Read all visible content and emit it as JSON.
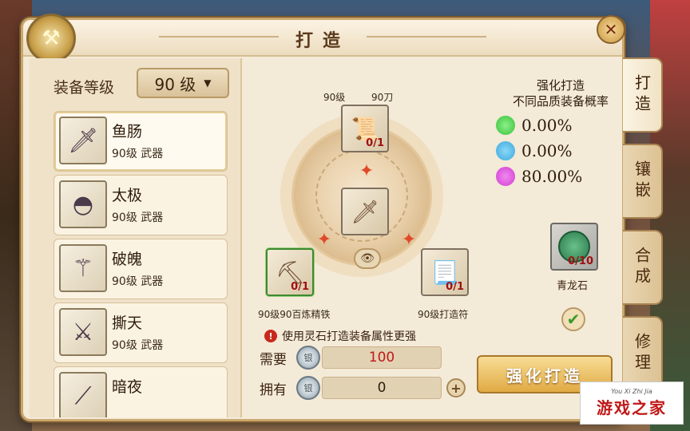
{
  "title": "打造",
  "level": {
    "label": "装备等级",
    "value": "90 级"
  },
  "items": [
    {
      "name": "鱼肠",
      "sub": "90级 武器",
      "icon": "dagger-icon"
    },
    {
      "name": "太极",
      "sub": "90级 武器",
      "icon": "fan-icon"
    },
    {
      "name": "破魄",
      "sub": "90级 武器",
      "icon": "staff-icon"
    },
    {
      "name": "撕天",
      "sub": "90级 武器",
      "icon": "claw-icon"
    },
    {
      "name": "暗夜",
      "sub": "",
      "icon": "blade-icon"
    }
  ],
  "forge": {
    "top_slot": {
      "caption_left": "90级",
      "caption_right": "90刀",
      "count": "0/1",
      "icon": "scroll-icon"
    },
    "center_slot": {
      "icon": "dagger-icon"
    },
    "left_slot": {
      "caption": "90级90百炼精铁",
      "count": "0/1",
      "icon": "iron-ore-icon"
    },
    "right_slot": {
      "caption": "90级打造符",
      "count": "0/1",
      "icon": "talisman-icon"
    }
  },
  "notice": "使用灵石打造装备属性更强",
  "cost": {
    "need_label": "需要",
    "need_value": "100",
    "have_label": "拥有",
    "have_value": "0"
  },
  "probability": {
    "title_line1": "强化打造",
    "title_line2": "不同品质装备概率",
    "rows": [
      {
        "color": "#38c238",
        "value": "0.00%"
      },
      {
        "color": "#3aa8dc",
        "value": "0.00%"
      },
      {
        "color": "#d23ad0",
        "value": "80.00%"
      }
    ]
  },
  "stone": {
    "name": "青龙石",
    "count": "0/10"
  },
  "forge_button": "强化打造",
  "tabs": [
    "打造",
    "镶嵌",
    "合成",
    "修理"
  ],
  "watermark": {
    "small": "You Xi Zhi Jia",
    "main": "游戏之家"
  }
}
